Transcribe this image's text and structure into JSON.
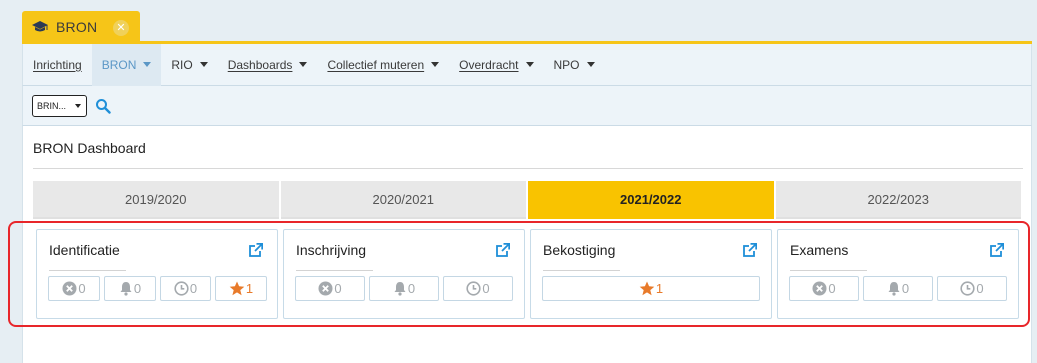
{
  "tab": {
    "label": "BRON",
    "icon": "graduation-cap-icon",
    "close_icon": "close-circle-icon",
    "color": "#f6c518"
  },
  "nav": {
    "items": [
      {
        "label": "Inrichting",
        "active": false,
        "caret": false
      },
      {
        "label": "BRON",
        "active": true,
        "caret": true
      },
      {
        "label": "RIO",
        "active": false,
        "caret": true
      },
      {
        "label": "Dashboards",
        "active": false,
        "caret": true
      },
      {
        "label": "Collectief muteren",
        "active": false,
        "caret": true
      },
      {
        "label": "Overdracht",
        "active": false,
        "caret": true
      },
      {
        "label": "NPO",
        "active": false,
        "caret": true
      }
    ]
  },
  "toolbar": {
    "select_value": "BRIN...",
    "search_icon": "search-icon"
  },
  "page_title": "BRON Dashboard",
  "years": [
    {
      "label": "2019/2020",
      "active": false
    },
    {
      "label": "2020/2021",
      "active": false
    },
    {
      "label": "2021/2022",
      "active": true
    },
    {
      "label": "2022/2023",
      "active": false
    }
  ],
  "cards": [
    {
      "title": "Identificatie",
      "badges": [
        {
          "icon": "x-circle-icon",
          "count": "0"
        },
        {
          "icon": "bell-icon",
          "count": "0"
        },
        {
          "icon": "clock-icon",
          "count": "0"
        },
        {
          "icon": "star-icon",
          "count": "1"
        }
      ]
    },
    {
      "title": "Inschrijving",
      "badges": [
        {
          "icon": "x-circle-icon",
          "count": "0"
        },
        {
          "icon": "bell-icon",
          "count": "0"
        },
        {
          "icon": "clock-icon",
          "count": "0"
        }
      ]
    },
    {
      "title": "Bekostiging",
      "badges": [
        {
          "icon": "star-icon",
          "count": "1"
        }
      ]
    },
    {
      "title": "Examens",
      "badges": [
        {
          "icon": "x-circle-icon",
          "count": "0"
        },
        {
          "icon": "bell-icon",
          "count": "0"
        },
        {
          "icon": "clock-icon",
          "count": "0"
        }
      ]
    }
  ],
  "colors": {
    "accent": "#f9c300",
    "link_blue": "#5b97c6",
    "star_orange": "#e87a2a",
    "highlight_red": "#e8262a"
  }
}
